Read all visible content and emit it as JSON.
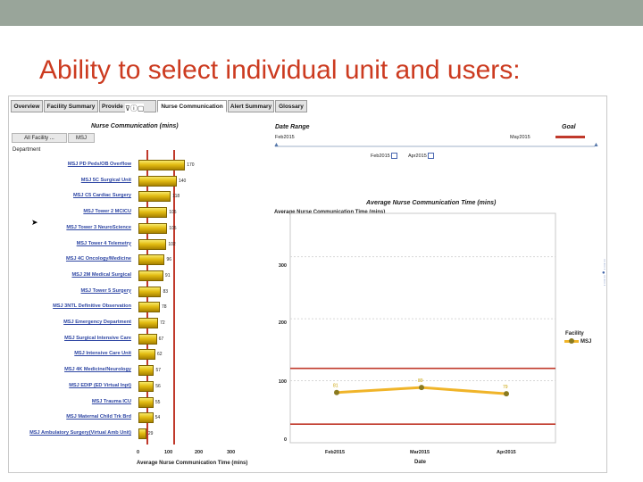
{
  "slide_title": "Ability to select individual unit and users:",
  "tabs": [
    {
      "label": "Overview"
    },
    {
      "label": "Facility Summary"
    },
    {
      "label": "Provide"
    },
    {
      "label": "Nurse Communication"
    },
    {
      "label": "Alert Summary"
    },
    {
      "label": "Glossary"
    }
  ],
  "left_panel": {
    "title": "Nurse Communication (mins)",
    "breadcrumbs": [
      "All Facility ...",
      "MSJ"
    ],
    "department_label": "Department",
    "x_axis_title": "Average Nurse Communication Time (mins)"
  },
  "date_range": {
    "title": "Date Range",
    "goal_label": "Goal",
    "range_start": "Feb2015",
    "range_end": "May2015",
    "selected_start": "Feb2015",
    "selected_end": "Apr2015"
  },
  "right_panel": {
    "legend_title": "Facility",
    "legend_item": "MSJ"
  },
  "colors": {
    "title_red": "#cc3b20",
    "goal_red": "#c0392b",
    "bar_gold": "#e3bc12",
    "line_orange": "#f0b429",
    "link_blue": "#2f47a4"
  },
  "chart_data": [
    {
      "type": "bar",
      "orientation": "horizontal",
      "title": "Nurse Communication (mins)",
      "xlabel": "Average Nurse Communication Time (mins)",
      "ylabel": "Department",
      "xlim": [
        0,
        400
      ],
      "xticks": [
        "0",
        "100",
        "200",
        "300"
      ],
      "categories": [
        "MSJ PD Peds/OB Overflow",
        "MSJ 5C Surgical Unit",
        "MSJ C5 Cardiac Surgery",
        "MSJ Tower 2 MCICU",
        "MSJ Tower 3 NeuroScience",
        "MSJ Tower 4 Telemetry",
        "MSJ 4C Oncology/Medicine",
        "MSJ 2M Medical Surgical",
        "MSJ Tower 5 Surgery",
        "MSJ 3NTL Definitive Observation",
        "MSJ Emergency Department",
        "MSJ Surgical Intensive Care",
        "MSJ Intensive Care Unit",
        "MSJ 4K Medicine/Neurology",
        "MSJ EDIP (ED Virtual Inpt)",
        "MSJ Trauma ICU",
        "MSJ Maternal Child Trk Brd",
        "MSJ Ambulatory Surgery(Virtual Amb Unit)"
      ],
      "values": [
        170,
        140,
        118,
        105,
        105,
        102,
        96,
        91,
        83,
        78,
        72,
        67,
        62,
        57,
        56,
        55,
        54,
        29
      ],
      "reference_lines": [
        10,
        120
      ]
    },
    {
      "type": "line",
      "title": "Average Nurse Communication Time (mins)",
      "xlabel": "Date",
      "ylabel": "Average Nurse Communication Time (mins)",
      "ylim": [
        0,
        370
      ],
      "yticks": [
        "0",
        "100",
        "200",
        "300"
      ],
      "x": [
        "Feb2015",
        "Mar2015",
        "Apr2015"
      ],
      "series": [
        {
          "name": "MSJ",
          "values": [
            81,
            89,
            79
          ]
        }
      ],
      "goal_lines": [
        120,
        30
      ],
      "legend": "right"
    }
  ]
}
